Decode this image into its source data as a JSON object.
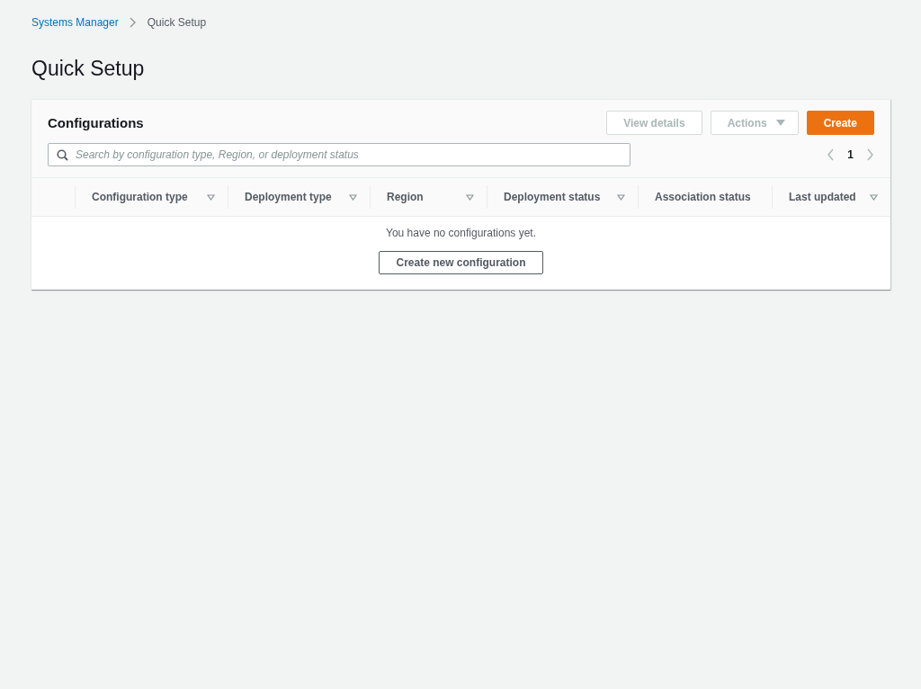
{
  "breadcrumbs": [
    {
      "label": "Systems Manager",
      "kind": "link"
    },
    {
      "label": "Quick Setup",
      "kind": "current"
    }
  ],
  "page_title": "Quick Setup",
  "panel": {
    "title": "Configurations",
    "buttons": [
      {
        "label": "View details",
        "kind": "normal",
        "disabled": true
      },
      {
        "label": "Actions",
        "kind": "dropdown",
        "disabled": true
      },
      {
        "label": "Create",
        "kind": "primary",
        "disabled": false
      }
    ],
    "search": {
      "placeholder": "Search by configuration type, Region, or deployment status"
    },
    "pagination": {
      "page": "1"
    },
    "columns": [
      {
        "label": "Configuration type",
        "sortable": true
      },
      {
        "label": "Deployment type",
        "sortable": true
      },
      {
        "label": "Region",
        "sortable": true
      },
      {
        "label": "Deployment status",
        "sortable": true
      },
      {
        "label": "Association status",
        "sortable": false
      },
      {
        "label": "Last updated",
        "sortable": true
      }
    ],
    "empty_message": "You have no configurations yet.",
    "empty_button": "Create new configuration"
  }
}
